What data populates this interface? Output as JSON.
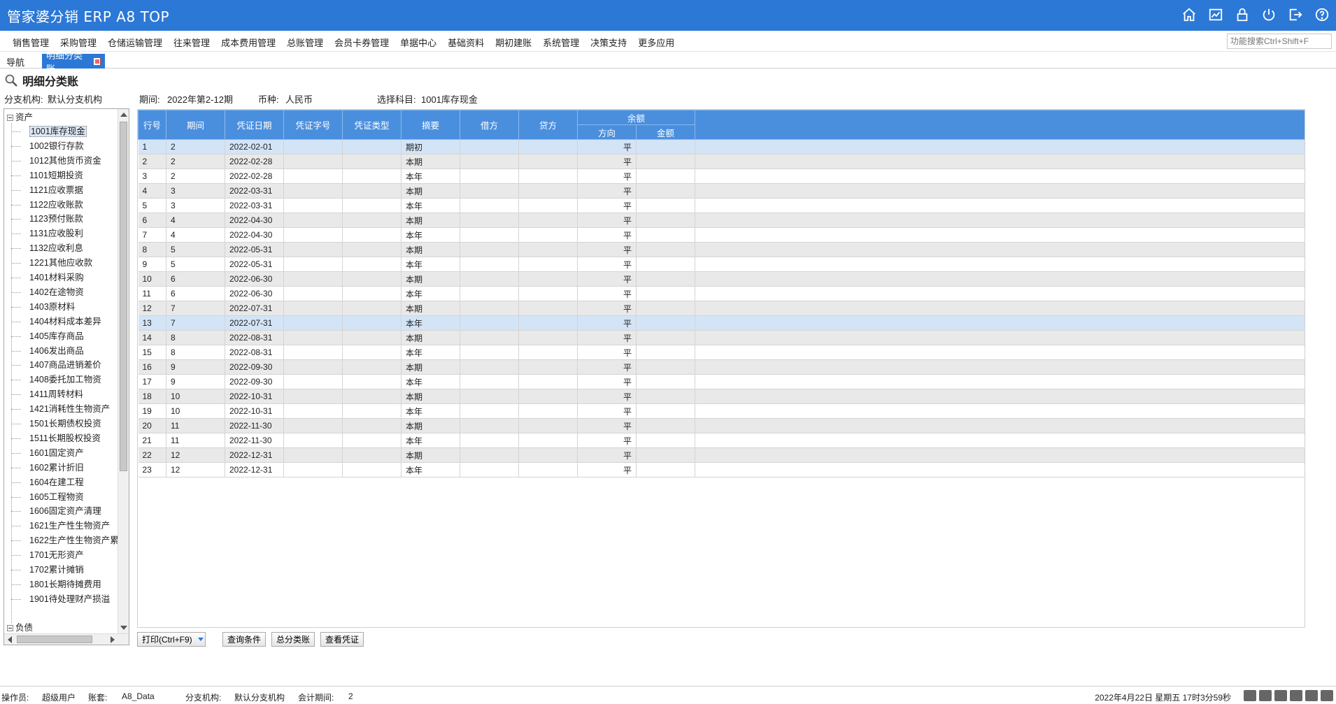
{
  "app": {
    "title": "管家婆分销 ERP A8 TOP"
  },
  "titlebar_icons": [
    "home-icon",
    "chart-icon",
    "lock-icon",
    "power-icon",
    "logout-icon",
    "help-icon"
  ],
  "menu": [
    "销售管理",
    "采购管理",
    "仓储运输管理",
    "往来管理",
    "成本费用管理",
    "总账管理",
    "会员卡券管理",
    "单据中心",
    "基础资料",
    "期初建账",
    "系统管理",
    "决策支持",
    "更多应用"
  ],
  "search": {
    "placeholder": "功能搜索Ctrl+Shift+F"
  },
  "tabs": {
    "nav": "导航",
    "active": "明细分类账"
  },
  "page": {
    "title": "明细分类账"
  },
  "filters": {
    "branch_label": "分支机构:",
    "branch_value": "默认分支机构",
    "period_label": "期间:",
    "period_value": "2022年第2-12期",
    "currency_label": "币种:",
    "currency_value": "人民币",
    "subject_label": "选择科目:",
    "subject_value": "1001库存现金"
  },
  "tree": {
    "group_assets": "资产",
    "group_liab": "负债",
    "items": [
      "1001库存现金",
      "1002银行存款",
      "1012其他货币资金",
      "1101短期投资",
      "1121应收票据",
      "1122应收账款",
      "1123预付账款",
      "1131应收股利",
      "1132应收利息",
      "1221其他应收款",
      "1401材料采购",
      "1402在途物资",
      "1403原材料",
      "1404材料成本差异",
      "1405库存商品",
      "1406发出商品",
      "1407商品进销差价",
      "1408委托加工物资",
      "1411周转材料",
      "1421消耗性生物资产",
      "1501长期债权投资",
      "1511长期股权投资",
      "1601固定资产",
      "1602累计折旧",
      "1604在建工程",
      "1605工程物资",
      "1606固定资产清理",
      "1621生产性生物资产",
      "1622生产性生物资产累",
      "1701无形资产",
      "1702累计摊销",
      "1801长期待摊费用",
      "1901待处理财产损溢"
    ]
  },
  "table": {
    "headers": {
      "row": "行号",
      "period": "期间",
      "date": "凭证日期",
      "voucher_no": "凭证字号",
      "voucher_type": "凭证类型",
      "summary": "摘要",
      "debit": "借方",
      "credit": "贷方",
      "balance": "余额",
      "direction": "方向",
      "amount": "金额"
    },
    "rows": [
      [
        "1",
        "2",
        "2022-02-01",
        "期初",
        "平"
      ],
      [
        "2",
        "2",
        "2022-02-28",
        "本期",
        "平"
      ],
      [
        "3",
        "2",
        "2022-02-28",
        "本年",
        "平"
      ],
      [
        "4",
        "3",
        "2022-03-31",
        "本期",
        "平"
      ],
      [
        "5",
        "3",
        "2022-03-31",
        "本年",
        "平"
      ],
      [
        "6",
        "4",
        "2022-04-30",
        "本期",
        "平"
      ],
      [
        "7",
        "4",
        "2022-04-30",
        "本年",
        "平"
      ],
      [
        "8",
        "5",
        "2022-05-31",
        "本期",
        "平"
      ],
      [
        "9",
        "5",
        "2022-05-31",
        "本年",
        "平"
      ],
      [
        "10",
        "6",
        "2022-06-30",
        "本期",
        "平"
      ],
      [
        "11",
        "6",
        "2022-06-30",
        "本年",
        "平"
      ],
      [
        "12",
        "7",
        "2022-07-31",
        "本期",
        "平"
      ],
      [
        "13",
        "7",
        "2022-07-31",
        "本年",
        "平"
      ],
      [
        "14",
        "8",
        "2022-08-31",
        "本期",
        "平"
      ],
      [
        "15",
        "8",
        "2022-08-31",
        "本年",
        "平"
      ],
      [
        "16",
        "9",
        "2022-09-30",
        "本期",
        "平"
      ],
      [
        "17",
        "9",
        "2022-09-30",
        "本年",
        "平"
      ],
      [
        "18",
        "10",
        "2022-10-31",
        "本期",
        "平"
      ],
      [
        "19",
        "10",
        "2022-10-31",
        "本年",
        "平"
      ],
      [
        "20",
        "11",
        "2022-11-30",
        "本期",
        "平"
      ],
      [
        "21",
        "11",
        "2022-11-30",
        "本年",
        "平"
      ],
      [
        "22",
        "12",
        "2022-12-31",
        "本期",
        "平"
      ],
      [
        "23",
        "12",
        "2022-12-31",
        "本年",
        "平"
      ]
    ],
    "highlighted_rows": [
      1,
      13
    ]
  },
  "actions": {
    "print": "打印(Ctrl+F9)",
    "query": "查询条件",
    "general_ledger": "总分类账",
    "view_voucher": "查看凭证"
  },
  "status": {
    "operator_label": "操作员:",
    "operator_value": "超级用户",
    "account_label": "账套:",
    "account_value": "A8_Data",
    "branch_label": "分支机构:",
    "branch_value": "默认分支机构",
    "period_label": "会计期间:",
    "period_value": "2",
    "datetime": "2022年4月22日  星期五  17时3分59秒"
  },
  "colors": {
    "primary": "#2b78d6",
    "header_cell": "#4a8fde",
    "row_alt": "#e9e9e9",
    "row_highlight": "#d3e4f7"
  }
}
